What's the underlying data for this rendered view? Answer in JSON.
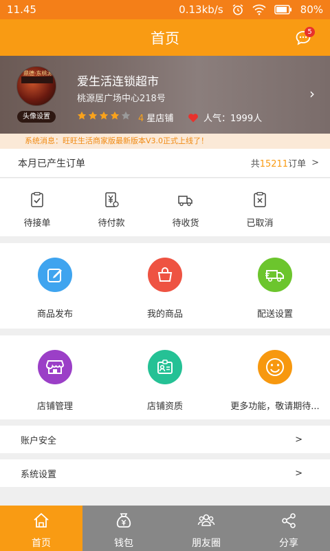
{
  "status_bar": {
    "time": "11.45",
    "net_speed": "0.13kb/s",
    "battery": "80%"
  },
  "header": {
    "title": "首页",
    "message_badge": "5"
  },
  "store": {
    "avatar_label": "头像设置",
    "avatar_sign": "鼎德·东桃源 书",
    "name": "爱生活连锁超市",
    "address": "桃源居广场中心218号",
    "rating_stars": 4,
    "rating_max": 5,
    "rating_num": "4",
    "rating_text": "星店铺",
    "popularity": "人气：1999人"
  },
  "notice": "系统消息：旺旺生活商家版最新版本V3.0正式上线了！",
  "orders": {
    "label": "本月已产生订单",
    "count_prefix": "共",
    "count": "15211",
    "count_suffix": "订单",
    "arrow": ">",
    "items": [
      {
        "label": "待接单",
        "icon": "clipboard-check-icon"
      },
      {
        "label": "待付款",
        "icon": "yuan-receipt-icon"
      },
      {
        "label": "待收货",
        "icon": "truck-icon"
      },
      {
        "label": "已取消",
        "icon": "clipboard-x-icon"
      }
    ]
  },
  "features_row1": [
    {
      "label": "商品发布",
      "color": "#3fa4ef",
      "icon": "edit-icon"
    },
    {
      "label": "我的商品",
      "color": "#ee5342",
      "icon": "basket-icon"
    },
    {
      "label": "配送设置",
      "color": "#6cc52d",
      "icon": "delivery-truck-icon"
    }
  ],
  "features_row2": [
    {
      "label": "店铺管理",
      "color": "#9b3fc7",
      "icon": "storefront-icon"
    },
    {
      "label": "店铺资质",
      "color": "#25c195",
      "icon": "id-card-icon"
    },
    {
      "label": "更多功能，敬请期待...",
      "color": "#f7980f",
      "icon": "smile-icon"
    }
  ],
  "settings": [
    {
      "label": "账户安全",
      "arrow": ">"
    },
    {
      "label": "系统设置",
      "arrow": ">"
    }
  ],
  "tabs": [
    {
      "label": "首页",
      "icon": "home-icon",
      "active": true
    },
    {
      "label": "钱包",
      "icon": "money-bag-icon",
      "active": false
    },
    {
      "label": "朋友圈",
      "icon": "friends-icon",
      "active": false
    },
    {
      "label": "分享",
      "icon": "share-icon",
      "active": false
    }
  ],
  "colors": {
    "accent": "#f99b13",
    "status_bar": "#f47f18",
    "tab_inactive": "#878787",
    "notice_text": "#f08a12"
  }
}
